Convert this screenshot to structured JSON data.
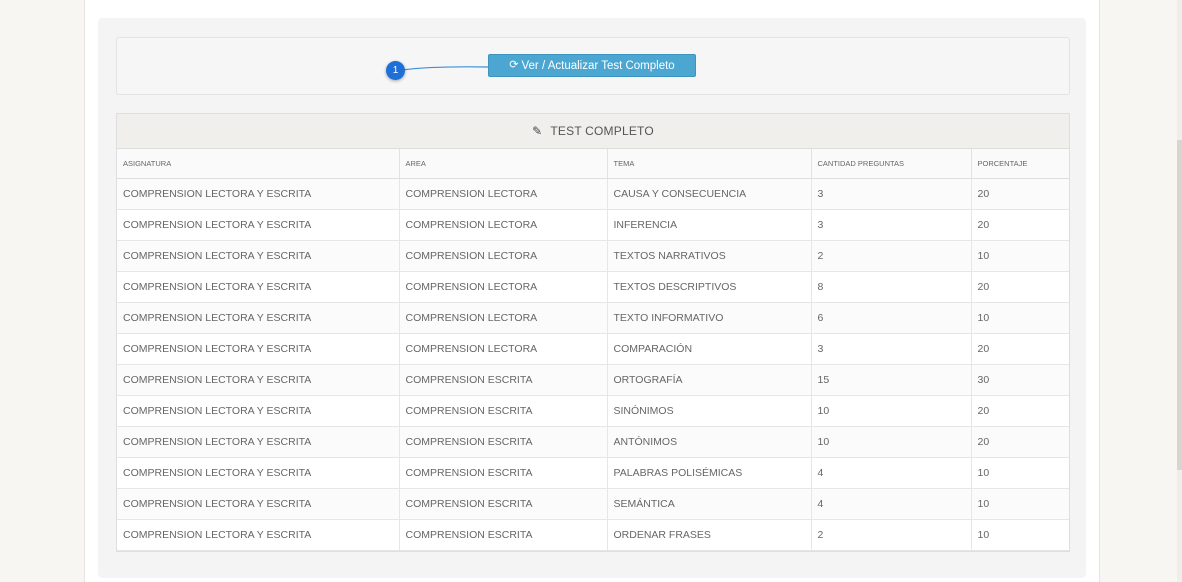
{
  "action": {
    "button_label": "Ver / Actualizar Test Completo",
    "refresh_icon": "refresh-icon",
    "step_number": "1"
  },
  "table": {
    "title": "TEST COMPLETO",
    "title_icon": "pencil-icon",
    "headers": [
      "ASIGNATURA",
      "AREA",
      "TEMA",
      "CANTIDAD PREGUNTAS",
      "PORCENTAJE"
    ],
    "rows": [
      [
        "COMPRENSION LECTORA Y ESCRITA",
        "COMPRENSION LECTORA",
        "CAUSA Y CONSECUENCIA",
        "3",
        "20"
      ],
      [
        "COMPRENSION LECTORA Y ESCRITA",
        "COMPRENSION LECTORA",
        "INFERENCIA",
        "3",
        "20"
      ],
      [
        "COMPRENSION LECTORA Y ESCRITA",
        "COMPRENSION LECTORA",
        "TEXTOS NARRATIVOS",
        "2",
        "10"
      ],
      [
        "COMPRENSION LECTORA Y ESCRITA",
        "COMPRENSION LECTORA",
        "TEXTOS DESCRIPTIVOS",
        "8",
        "20"
      ],
      [
        "COMPRENSION LECTORA Y ESCRITA",
        "COMPRENSION LECTORA",
        "TEXTO INFORMATIVO",
        "6",
        "10"
      ],
      [
        "COMPRENSION LECTORA Y ESCRITA",
        "COMPRENSION LECTORA",
        "COMPARACIÓN",
        "3",
        "20"
      ],
      [
        "COMPRENSION LECTORA Y ESCRITA",
        "COMPRENSION ESCRITA",
        "ORTOGRAFÍA",
        "15",
        "30"
      ],
      [
        "COMPRENSION LECTORA Y ESCRITA",
        "COMPRENSION ESCRITA",
        "SINÓNIMOS",
        "10",
        "20"
      ],
      [
        "COMPRENSION LECTORA Y ESCRITA",
        "COMPRENSION ESCRITA",
        "ANTÓNIMOS",
        "10",
        "20"
      ],
      [
        "COMPRENSION LECTORA Y ESCRITA",
        "COMPRENSION ESCRITA",
        "PALABRAS POLISÉMICAS",
        "4",
        "10"
      ],
      [
        "COMPRENSION LECTORA Y ESCRITA",
        "COMPRENSION ESCRITA",
        "SEMÁNTICA",
        "4",
        "10"
      ],
      [
        "COMPRENSION LECTORA Y ESCRITA",
        "COMPRENSION ESCRITA",
        "ORDENAR FRASES",
        "2",
        "10"
      ]
    ]
  },
  "colors": {
    "button": "#4ba7d2",
    "badge": "#1e6fd6"
  }
}
